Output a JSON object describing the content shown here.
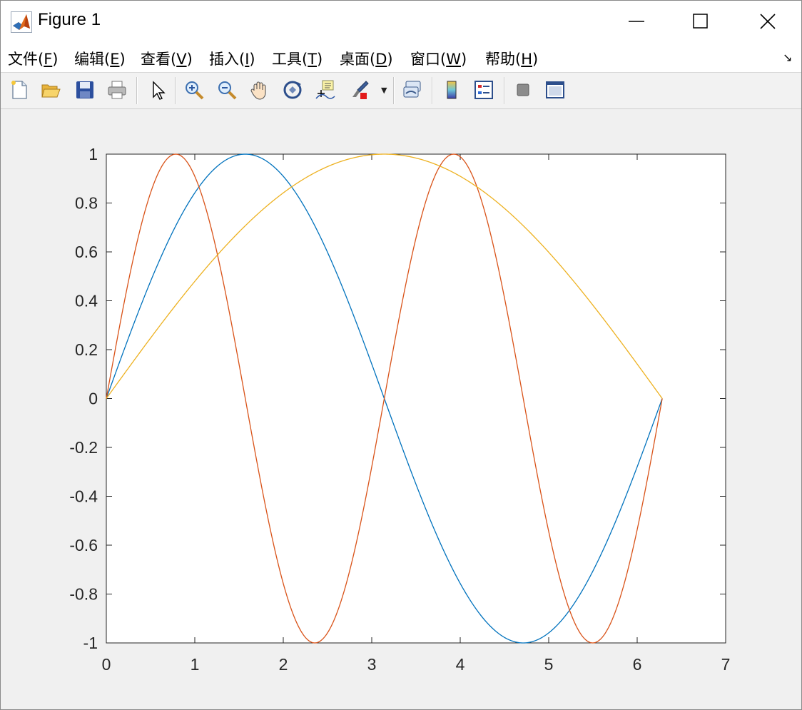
{
  "window": {
    "title": "Figure 1"
  },
  "menu": {
    "items": [
      {
        "label": "文件(",
        "key": "F",
        "tail": ")"
      },
      {
        "label": "编辑(",
        "key": "E",
        "tail": ")"
      },
      {
        "label": "查看(",
        "key": "V",
        "tail": ")"
      },
      {
        "label": "插入(",
        "key": "I",
        "tail": ")"
      },
      {
        "label": "工具(",
        "key": "T",
        "tail": ")"
      },
      {
        "label": "桌面(",
        "key": "D",
        "tail": ")"
      },
      {
        "label": "窗口(",
        "key": "W",
        "tail": ")"
      },
      {
        "label": "帮助(",
        "key": "H",
        "tail": ")"
      }
    ]
  },
  "toolbar": {
    "icons": [
      "new-figure-icon",
      "open-file-icon",
      "save-icon",
      "print-icon",
      "edit-plot-icon",
      "zoom-in-icon",
      "zoom-out-icon",
      "pan-icon",
      "rotate-3d-icon",
      "data-cursor-icon",
      "brush-icon",
      "link-plot-icon",
      "colorbar-icon",
      "legend-icon",
      "hide-plot-tools-icon",
      "show-plot-tools-icon"
    ]
  },
  "colors": {
    "series1": "#0072BD",
    "series2": "#D95319",
    "series3": "#EDB120"
  },
  "chart_data": {
    "type": "line",
    "xlim": [
      0,
      7
    ],
    "ylim": [
      -1,
      1
    ],
    "xticks": [
      "0",
      "1",
      "2",
      "3",
      "4",
      "5",
      "6",
      "7"
    ],
    "yticks": [
      "1",
      "0.8",
      "0.6",
      "0.4",
      "0.2",
      "0",
      "-0.2",
      "-0.4",
      "-0.6",
      "-0.8",
      "-1"
    ],
    "grid": false,
    "series": [
      {
        "function": "sin(x)",
        "x_range": [
          0,
          6.2832
        ],
        "color": "#0072BD"
      },
      {
        "function": "sin(2x)",
        "x_range": [
          0,
          6.2832
        ],
        "color": "#D95319"
      },
      {
        "function": "sin(x/2)",
        "x_range": [
          0,
          6.2832
        ],
        "color": "#EDB120"
      }
    ]
  }
}
